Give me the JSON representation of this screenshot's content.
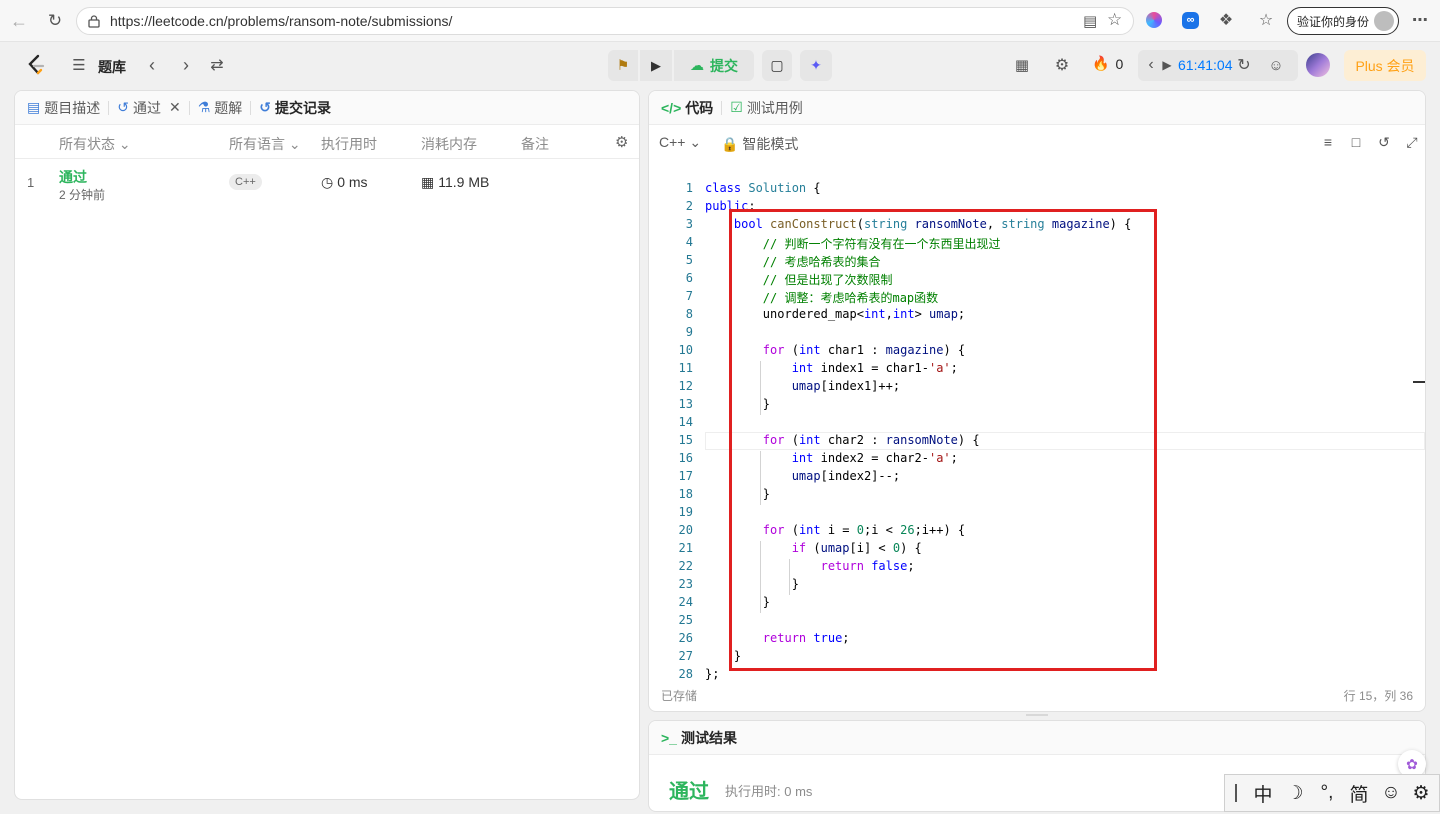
{
  "browser": {
    "url": "https://leetcode.cn/problems/ransom-note/submissions/",
    "verify_label": "验证你的身份"
  },
  "nav": {
    "problem_list": "题库",
    "submit": "提交",
    "fire_count": "0",
    "timer": "61:41:04",
    "plus": "Plus 会员"
  },
  "left": {
    "tabs": [
      "题目描述",
      "通过",
      "题解",
      "提交记录"
    ],
    "headers": {
      "status": "所有状态",
      "lang": "所有语言",
      "time": "执行用时",
      "mem": "消耗内存",
      "note": "备注"
    },
    "rows": [
      {
        "index": "1",
        "status": "通过",
        "ago": "2 分钟前",
        "lang": "C++",
        "time": "0 ms",
        "mem": "11.9 MB"
      }
    ]
  },
  "editor": {
    "tabs": [
      "代码",
      "测试用例"
    ],
    "language": "C++",
    "mode": "智能模式",
    "saved": "已存储",
    "cursor": "行 15，列 36",
    "lines": [
      "class Solution {",
      "public:",
      "    bool canConstruct(string ransomNote, string magazine) {",
      "        // 判断一个字符有没有在一个东西里出现过",
      "        // 考虑哈希表的集合",
      "        // 但是出现了次数限制",
      "        // 调整：考虑哈希表的map函数",
      "        unordered_map<int,int> umap;",
      "",
      "        for (int char1 : magazine) {",
      "            int index1 = char1-'a';",
      "            umap[index1]++;",
      "        }",
      "",
      "        for (int char2 : ransomNote) {",
      "            int index2 = char2-'a';",
      "            umap[index2]--;",
      "        }",
      "",
      "        for (int i = 0;i < 26;i++) {",
      "            if (umap[i] < 0) {",
      "                return false;",
      "            }",
      "        }",
      "",
      "        return true;",
      "    }",
      "};"
    ]
  },
  "result": {
    "title": "测试结果",
    "status": "通过",
    "runtime": "执行用时: 0 ms"
  },
  "ime": {
    "items": [
      "中",
      "☽",
      "°,",
      "简",
      "☺",
      "⚙"
    ]
  },
  "colors": {
    "accent_green": "#2db55d",
    "submit_green": "#2db55d",
    "timer_blue": "#007aff",
    "plus_orange": "#ffa116",
    "highlight_red": "#e02020"
  }
}
